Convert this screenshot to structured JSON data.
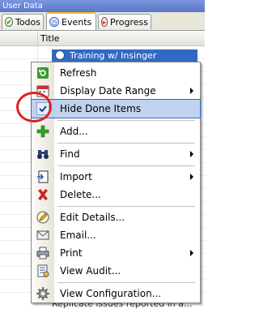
{
  "window": {
    "title": "User Data"
  },
  "tabs": [
    {
      "label": "Todos",
      "icon": "check-circle-icon"
    },
    {
      "label": "Events",
      "icon": "clock-icon"
    },
    {
      "label": "Progress",
      "icon": "progress-icon"
    }
  ],
  "grid": {
    "column_title": "Title",
    "selected_row": "Training w/ Insinger",
    "bottom_row": "Replicate issues reported in a..."
  },
  "menu": {
    "items": [
      {
        "label": "Refresh",
        "icon": "refresh-icon"
      },
      {
        "label": "Display Date Range",
        "icon": "calendar-icon",
        "submenu": true
      },
      {
        "label": "Hide Done Items",
        "icon": "checkmark-icon",
        "checked": true
      },
      {
        "label": "Add...",
        "icon": "plus-icon"
      },
      {
        "label": "Find",
        "icon": "binoculars-icon",
        "submenu": true
      },
      {
        "label": "Import",
        "icon": "import-icon",
        "submenu": true
      },
      {
        "label": "Delete...",
        "icon": "delete-x-icon"
      },
      {
        "label": "Edit Details...",
        "icon": "pencil-icon"
      },
      {
        "label": "Email...",
        "icon": "envelope-icon"
      },
      {
        "label": "Print",
        "icon": "printer-icon",
        "submenu": true
      },
      {
        "label": "View Audit...",
        "icon": "audit-icon"
      },
      {
        "label": "View Configuration...",
        "icon": "gear-icon"
      }
    ]
  },
  "colors": {
    "selection": "#316ac5",
    "highlight": "#c1d2ee",
    "annotation": "#e02020"
  }
}
